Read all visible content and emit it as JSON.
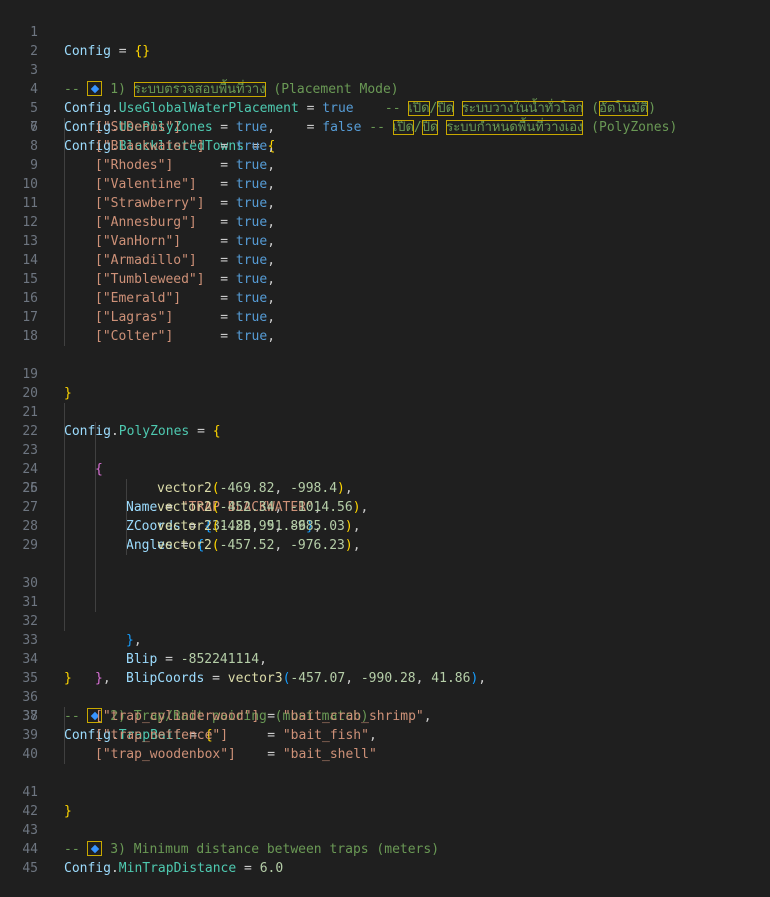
{
  "editor": {
    "line_numbers": [
      "1",
      "2",
      "3",
      "4",
      "5",
      "6",
      "7",
      "8",
      "9",
      "10",
      "11",
      "12",
      "13",
      "14",
      "15",
      "16",
      "17",
      "18",
      "19",
      "20",
      "21",
      "22",
      "23",
      "24",
      "25",
      "26",
      "27",
      "28",
      "29",
      "30",
      "31",
      "32",
      "33",
      "34",
      "35",
      "36",
      "37",
      "38",
      "39",
      "40",
      "41",
      "42",
      "43",
      "44",
      "45"
    ],
    "l1": {
      "config": "Config",
      "op": " = ",
      "open": "{",
      "close": "}"
    },
    "l3": {
      "prefix": "-- ",
      "icon": "diamond-icon",
      "num": " 1) ",
      "thai": "ระบบตรวจสอบพื้นที่วาง",
      "rest": " (Placement Mode)"
    },
    "l4": {
      "config": "Config",
      "dot": ".",
      "field": "UseGlobalWaterPlacement",
      "op": " = ",
      "value": "true",
      "cmt1": "    -- ",
      "t1": "เปิด",
      "slash": "/",
      "t2": "ปิด",
      "sp": " ",
      "t3": "ระบบวางในน้ำทั่วโลก",
      "sp2": " (",
      "t4": "อัตโนมัติ",
      "close": ")"
    },
    "l5": {
      "config": "Config",
      "dot": ".",
      "field": "UsePolyZones",
      "op": "            = ",
      "value": "false",
      "cmt1": " -- ",
      "t1": "เปิด",
      "slash": "/",
      "t2": "ปิด",
      "sp": " ",
      "t3": "ระบบกำหนดพื้นที่วางเอง",
      "rest": " (PolyZones)"
    },
    "l6": {
      "config": "Config",
      "dot": ".",
      "field": "BlacklistedTowns",
      "op": " = ",
      "open": "{"
    },
    "towns": [
      {
        "key": "[\"StDenis\"]",
        "pad": "     = ",
        "value": "true",
        "end": ","
      },
      {
        "key": "[\"Blackwater\"]",
        "pad": "  = ",
        "value": "true",
        "end": ","
      },
      {
        "key": "[\"Rhodes\"]",
        "pad": "      = ",
        "value": "true",
        "end": ","
      },
      {
        "key": "[\"Valentine\"]",
        "pad": "   = ",
        "value": "true",
        "end": ","
      },
      {
        "key": "[\"Strawberry\"]",
        "pad": "  = ",
        "value": "true",
        "end": ","
      },
      {
        "key": "[\"Annesburg\"]",
        "pad": "   = ",
        "value": "true",
        "end": ","
      },
      {
        "key": "[\"VanHorn\"]",
        "pad": "     = ",
        "value": "true",
        "end": ","
      },
      {
        "key": "[\"Armadillo\"]",
        "pad": "   = ",
        "value": "true",
        "end": ","
      },
      {
        "key": "[\"Tumbleweed\"]",
        "pad": "  = ",
        "value": "true",
        "end": ","
      },
      {
        "key": "[\"Emerald\"]",
        "pad": "     = ",
        "value": "true",
        "end": ","
      },
      {
        "key": "[\"Lagras\"]",
        "pad": "      = ",
        "value": "true",
        "end": ","
      },
      {
        "key": "[\"Colter\"]",
        "pad": "      = ",
        "value": "true",
        "end": ","
      }
    ],
    "l19": {
      "close": "}"
    },
    "l21": {
      "config": "Config",
      "dot": ".",
      "field": "PolyZones",
      "op": " = ",
      "open": "{"
    },
    "l22": {
      "open": "{"
    },
    "l23": {
      "key": "Name",
      "op": " = ",
      "value": "\"TRAP BLACKWATER\"",
      "end": ","
    },
    "l24": {
      "key": "ZCoords",
      "op": " = ",
      "open": "{",
      "a": "31.86",
      "sep": ", ",
      "b": "51.86",
      "close": "}",
      "end": ","
    },
    "l25": {
      "key": "Angles",
      "op": " = ",
      "open": "{"
    },
    "angles": [
      {
        "fn": "vector2",
        "open": "(",
        "x": "-469.82",
        "sep": ", ",
        "y": "-998.4",
        "close": ")",
        "end": ","
      },
      {
        "fn": "vector2",
        "open": "(",
        "x": "-452.34",
        "sep": ", ",
        "y": "-1014.56",
        "close": ")",
        "end": ","
      },
      {
        "fn": "vector2",
        "open": "(",
        "x": "-423.99",
        "sep": ", ",
        "y": "-985.03",
        "close": ")",
        "end": ","
      },
      {
        "fn": "vector2",
        "open": "(",
        "x": "-457.52",
        "sep": ", ",
        "y": "-976.23",
        "close": ")",
        "end": ","
      }
    ],
    "l30": {
      "close": "}",
      "end": ","
    },
    "l31": {
      "key": "Blip",
      "op": " = ",
      "value": "-852241114",
      "end": ","
    },
    "l32": {
      "key": "BlipCoords",
      "op": " = ",
      "fn": "vector3",
      "open": "(",
      "x": "-457.07",
      "sep1": ", ",
      "y": "-990.28",
      "sep2": ", ",
      "z": "41.86",
      "close": ")",
      "end": ","
    },
    "l33": {
      "close": "}",
      "end": ","
    },
    "l34": {
      "close": "}"
    },
    "l36": {
      "prefix": "-- ",
      "icon": "diamond-icon",
      "rest": " 2) Trap/Bait pairing (must match)"
    },
    "l37": {
      "config": "Config",
      "dot": ".",
      "field": "TrapBait",
      "op": " = ",
      "open": "{"
    },
    "baits": [
      {
        "key": "[\"trap_cylinderwood\"]",
        "pad": " = ",
        "value": "\"bait_crab_shrimp\"",
        "end": ","
      },
      {
        "key": "[\"trap_netfence\"]",
        "pad": "     = ",
        "value": "\"bait_fish\"",
        "end": ","
      },
      {
        "key": "[\"trap_woodenbox\"]",
        "pad": "    = ",
        "value": "\"bait_shell\"",
        "end": ""
      }
    ],
    "l41": {
      "close": "}"
    },
    "l43": {
      "prefix": "-- ",
      "icon": "diamond-icon",
      "rest": " 3) Minimum distance between traps (meters)"
    },
    "l44": {
      "config": "Config",
      "dot": ".",
      "field": "MinTrapDistance",
      "op": " = ",
      "value": "6.0"
    }
  }
}
